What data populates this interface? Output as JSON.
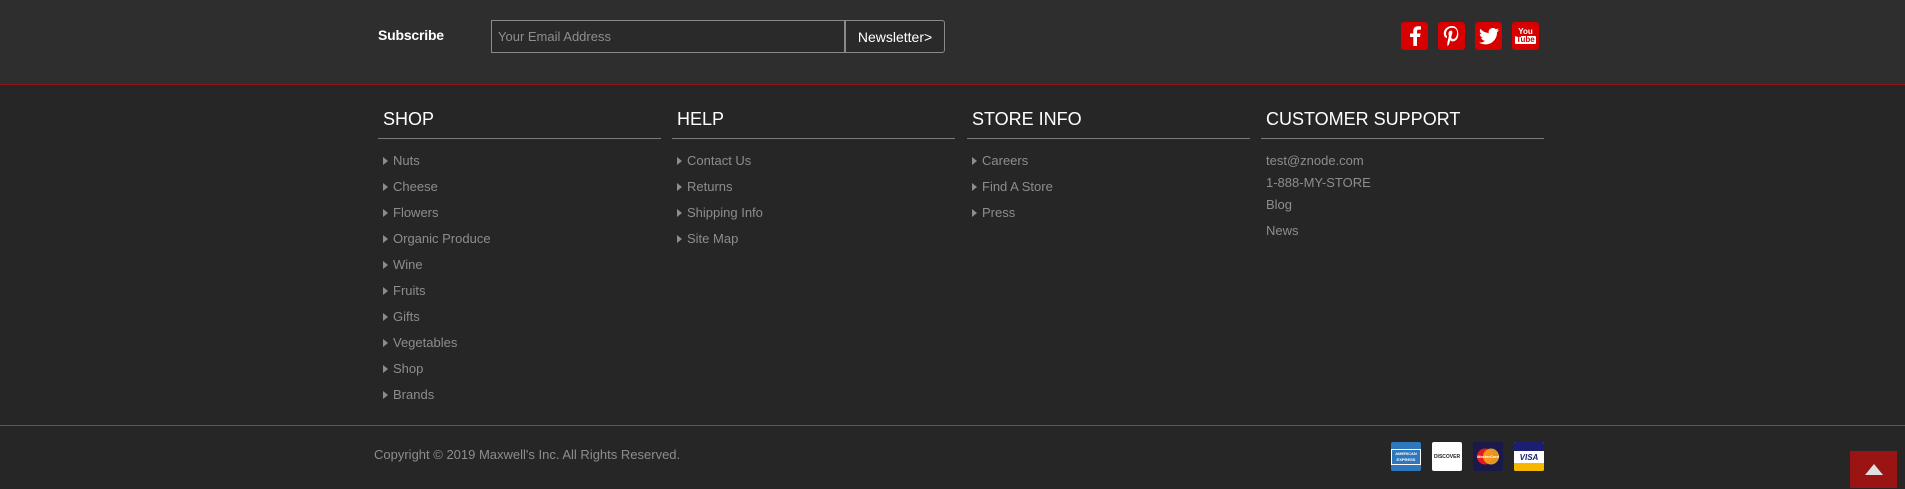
{
  "subscribe": {
    "label": "Subscribe",
    "email_placeholder": "Your Email Address",
    "email_value": "",
    "button_label": "Newsletter>"
  },
  "social": {
    "icons": [
      "facebook-icon",
      "pinterest-icon",
      "twitter-icon",
      "youtube-icon"
    ],
    "youtube_text_top": "You",
    "youtube_text_bottom": "Tube",
    "color": "#d60000"
  },
  "columns": {
    "shop": {
      "title": "SHOP",
      "items": [
        "Nuts",
        "Cheese",
        "Flowers",
        "Organic Produce",
        "Wine",
        "Fruits",
        "Gifts",
        "Vegetables",
        "Shop",
        "Brands"
      ]
    },
    "help": {
      "title": "HELP",
      "items": [
        "Contact Us",
        "Returns",
        "Shipping Info",
        "Site Map"
      ]
    },
    "store_info": {
      "title": "STORE INFO",
      "items": [
        "Careers",
        "Find A Store",
        "Press"
      ]
    },
    "customer_support": {
      "title": "CUSTOMER SUPPORT",
      "email": "test@znode.com",
      "phone": "1-888-MY-STORE",
      "blog": "Blog",
      "news": "News"
    }
  },
  "footer": {
    "copyright": "Copyright © 2019 Maxwell's Inc. All Rights Reserved.",
    "payment_cards": [
      {
        "icon": "amex-icon",
        "text": "AMERICAN EXPRESS"
      },
      {
        "icon": "discover-icon",
        "text": "DISCOVER"
      },
      {
        "icon": "mastercard-icon",
        "text": "MasterCard"
      },
      {
        "icon": "visa-icon",
        "text": "VISA"
      }
    ]
  },
  "colors": {
    "background": "#262626",
    "header_background": "#2e2e2e",
    "accent_red": "#d60000",
    "divider_red": "#8f1414",
    "link_gray": "#8d8d8d",
    "scroll_top_button": "#9a1414"
  }
}
